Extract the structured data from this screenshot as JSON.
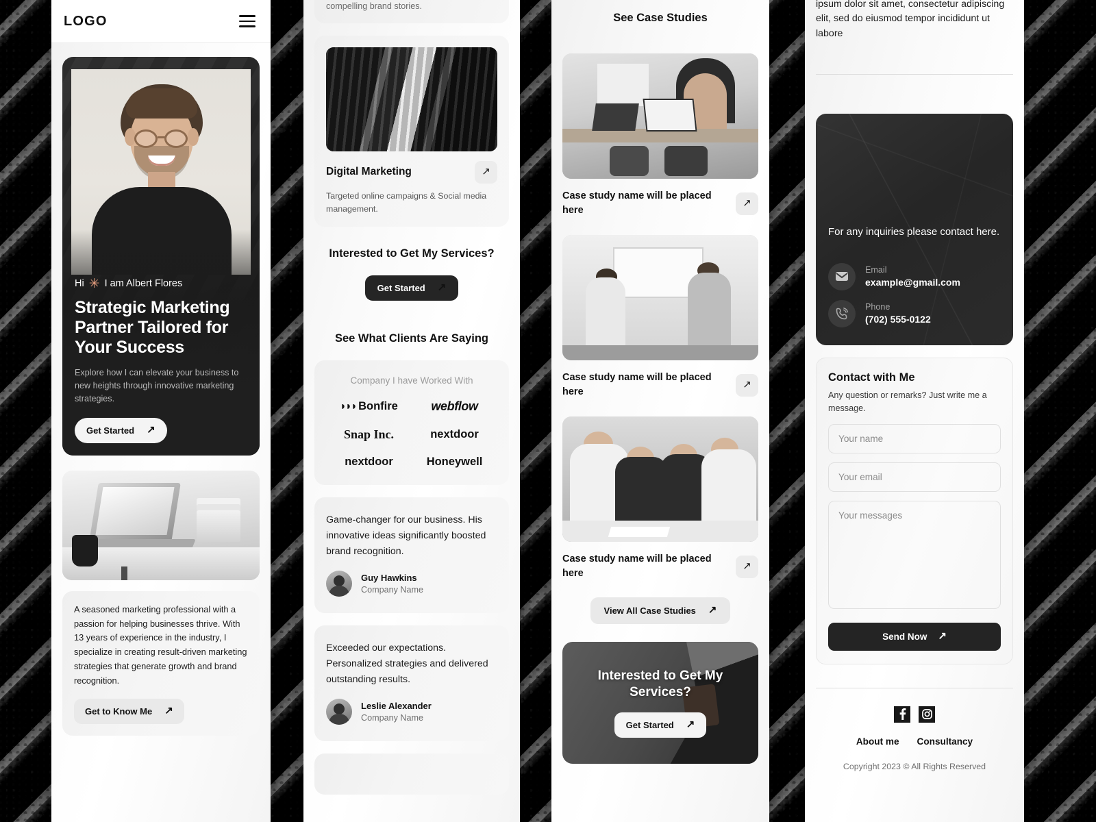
{
  "header": {
    "logo": "LOGO",
    "menu_icon": "hamburger-menu-icon"
  },
  "hero": {
    "greeting_prefix": "Hi",
    "star": "✳",
    "greeting": "I am Albert Flores",
    "headline": "Strategic Marketing Partner Tailored for Your Success",
    "subtext": "Explore how I can elevate your business to new heights through innovative marketing strategies.",
    "cta": "Get Started"
  },
  "about": {
    "text": "A seasoned marketing professional with a passion for helping businesses thrive. With 13 years of experience in the industry, I specialize in creating result-driven marketing strategies that generate growth and brand recognition.",
    "cta": "Get to Know Me"
  },
  "services": {
    "partial_text": "compelling brand stories.",
    "card": {
      "title": "Digital Marketing",
      "desc": "Targeted online campaigns & Social media management."
    },
    "cta_heading": "Interested to Get My Services?",
    "cta_button": "Get Started"
  },
  "testimonials": {
    "heading": "See What Clients Are Saying",
    "logos_label": "Company I have Worked With",
    "logos": [
      "Bonfire",
      "webflow",
      "Snap Inc.",
      "nextdoor",
      "nextdoor",
      "Honeywell"
    ],
    "items": [
      {
        "quote": "Game-changer for our business. His innovative ideas significantly boosted brand recognition.",
        "name": "Guy Hawkins",
        "company": "Company Name"
      },
      {
        "quote": "Exceeded our expectations. Personalized strategies and delivered outstanding results.",
        "name": "Leslie Alexander",
        "company": "Company Name"
      }
    ]
  },
  "case_studies": {
    "heading": "See Case Studies",
    "items": [
      {
        "name": "Case study name will be placed here"
      },
      {
        "name": "Case study name will be placed here"
      },
      {
        "name": "Case study name will be placed here"
      }
    ],
    "view_all": "View All Case Studies",
    "cta_heading": "Interested to Get My Services?",
    "cta_button": "Get Started"
  },
  "contact": {
    "lorem": "ipsum dolor sit amet, consectetur adipiscing elit, sed do eiusmod tempor incididunt ut labore",
    "lead": "For any inquiries please contact here.",
    "email_label": "Email",
    "email_value": "example@gmail.com",
    "phone_label": "Phone",
    "phone_value": "(702) 555-0122",
    "form": {
      "heading": "Contact with Me",
      "sub": "Any question or remarks? Just write me a message.",
      "name_placeholder": "Your name",
      "email_placeholder": "Your email",
      "message_placeholder": "Your messages",
      "submit": "Send Now"
    }
  },
  "footer": {
    "social": [
      "facebook-icon",
      "instagram-icon"
    ],
    "links": [
      "About me",
      "Consultancy"
    ],
    "copyright": "Copyright 2023 © All Rights Reserved"
  },
  "icons": {
    "arrow": "↗"
  },
  "colors": {
    "dark": "#242424",
    "accent": "#e79f7e",
    "surface": "#f1f1f1"
  }
}
